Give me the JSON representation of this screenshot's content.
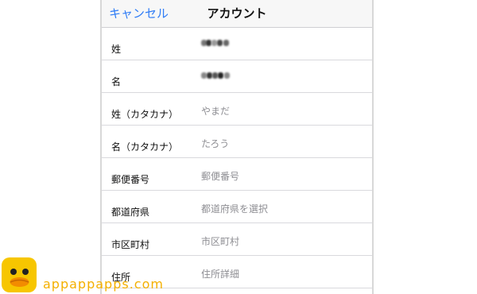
{
  "navbar": {
    "cancel_label": "キャンセル",
    "title": "アカウント"
  },
  "fields": [
    {
      "label": "姓",
      "value": "",
      "redacted": true
    },
    {
      "label": "名",
      "value": "",
      "redacted": true
    },
    {
      "label": "姓（カタカナ）",
      "value": "やまだ"
    },
    {
      "label": "名（カタカナ）",
      "value": "たろう"
    },
    {
      "label": "郵便番号",
      "value": "郵便番号"
    },
    {
      "label": "都道府県",
      "value": "都道府県を選択"
    },
    {
      "label": "市区町村",
      "value": "市区町村"
    },
    {
      "label": "住所",
      "value": "住所詳細"
    }
  ],
  "watermark": {
    "text": "appappapps.com",
    "color": "#f4b000"
  },
  "colors": {
    "accent": "#2f7cf6",
    "placeholder": "#8e8e93"
  }
}
